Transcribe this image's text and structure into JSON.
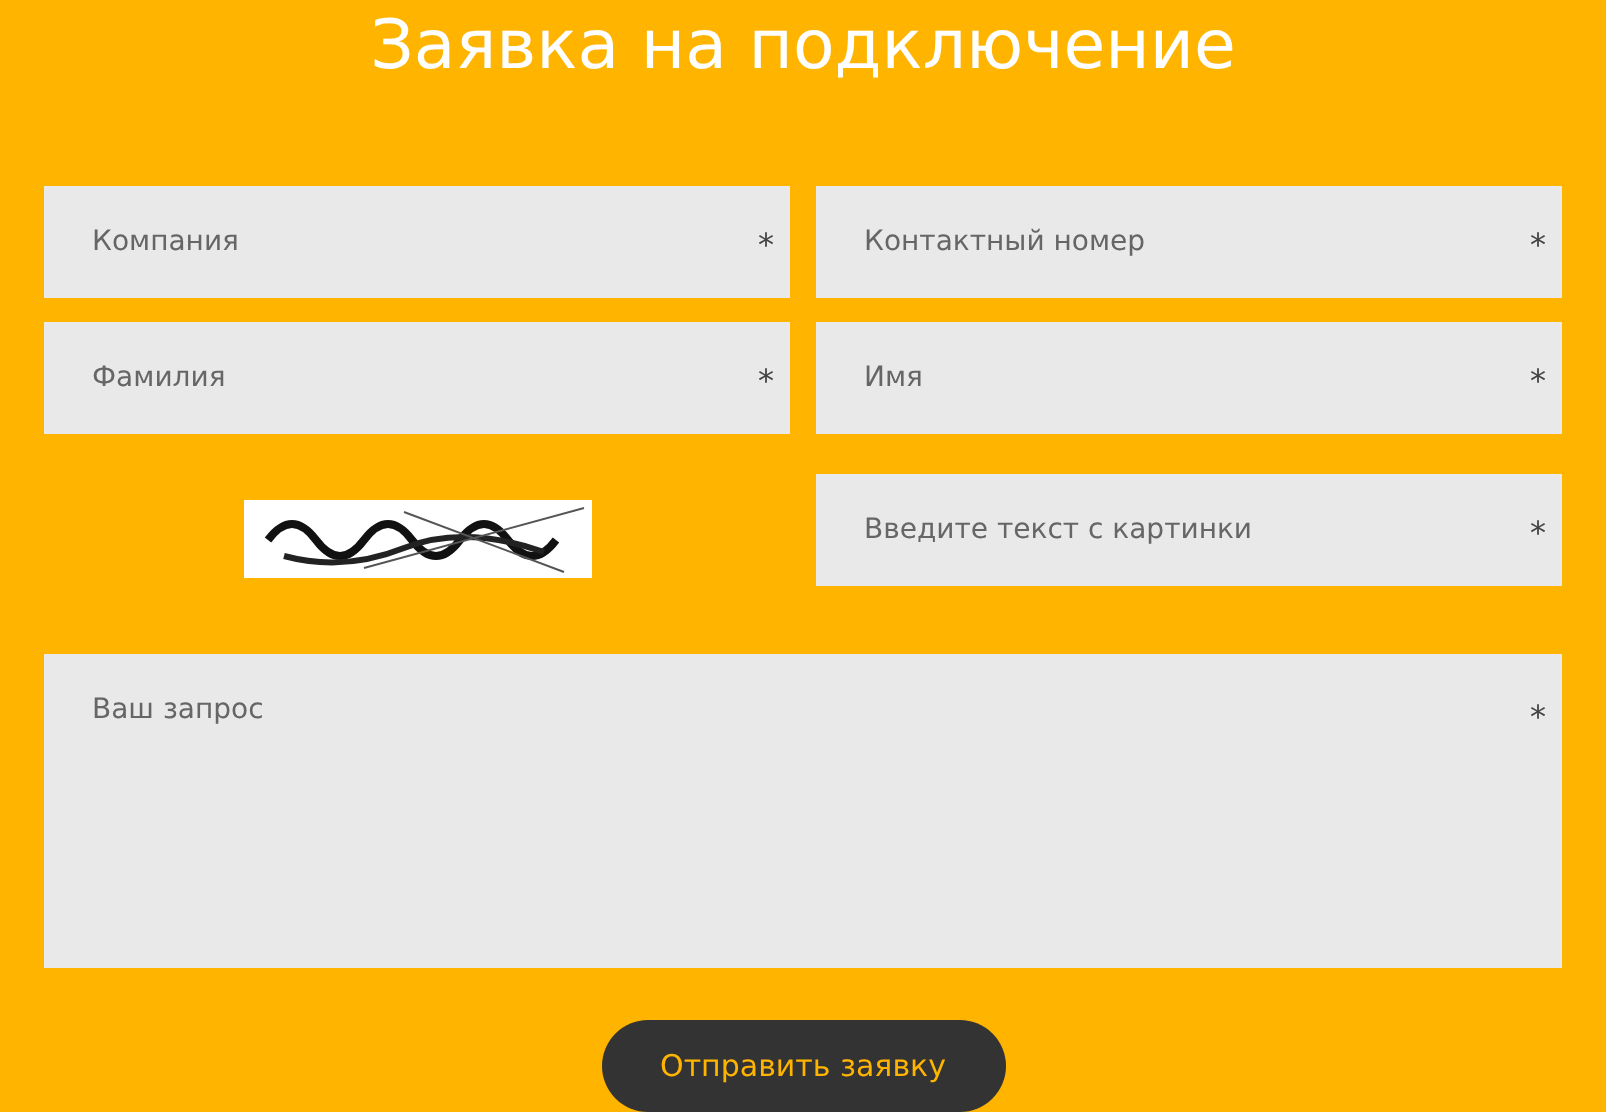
{
  "title": "Заявка на подключение",
  "fields": [
    {
      "placeholder": "Компания",
      "marker": "*"
    },
    {
      "placeholder": "Контактный номер",
      "marker": "*"
    },
    {
      "placeholder": "Фамилия",
      "marker": "*"
    },
    {
      "placeholder": "Имя",
      "marker": "*"
    }
  ],
  "captcha": {
    "kind": "picture",
    "field": {
      "placeholder": "Введите текст с картинки",
      "marker": "*"
    }
  },
  "request": {
    "placeholder": "Ваш запрос",
    "marker": "*"
  },
  "submit": "Отправить заявку"
}
